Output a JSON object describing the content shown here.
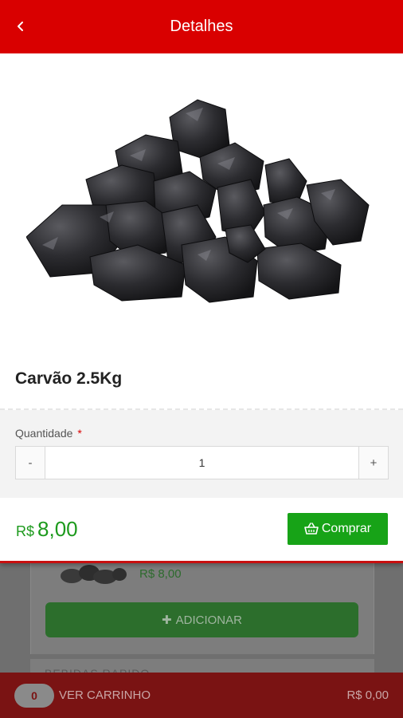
{
  "header": {
    "title": "Detalhes",
    "back_icon": "chevron-left-icon"
  },
  "product": {
    "name": "Carvão 2.5Kg",
    "image": "charcoal-pile-image"
  },
  "quantity": {
    "label": "Quantidade",
    "required_mark": "*",
    "minus_label": "-",
    "plus_label": "+",
    "value": "1"
  },
  "purchase": {
    "currency": "R$",
    "price": "8,00",
    "buy_label": "Comprar",
    "buy_icon": "basket-icon"
  },
  "background_list": {
    "item_price": "R$ 8,00",
    "add_label": "ADICIONAR",
    "next_card_label": "BEBIDAS RAPIDO"
  },
  "cart_bar": {
    "count": "0",
    "label": "VER CARRINHO",
    "total": "R$ 0,00"
  },
  "colors": {
    "header_red": "#d90000",
    "price_green": "#1d9a1d",
    "buy_button_green": "#17a317",
    "cart_bar_dimmed": "#7a1313"
  }
}
